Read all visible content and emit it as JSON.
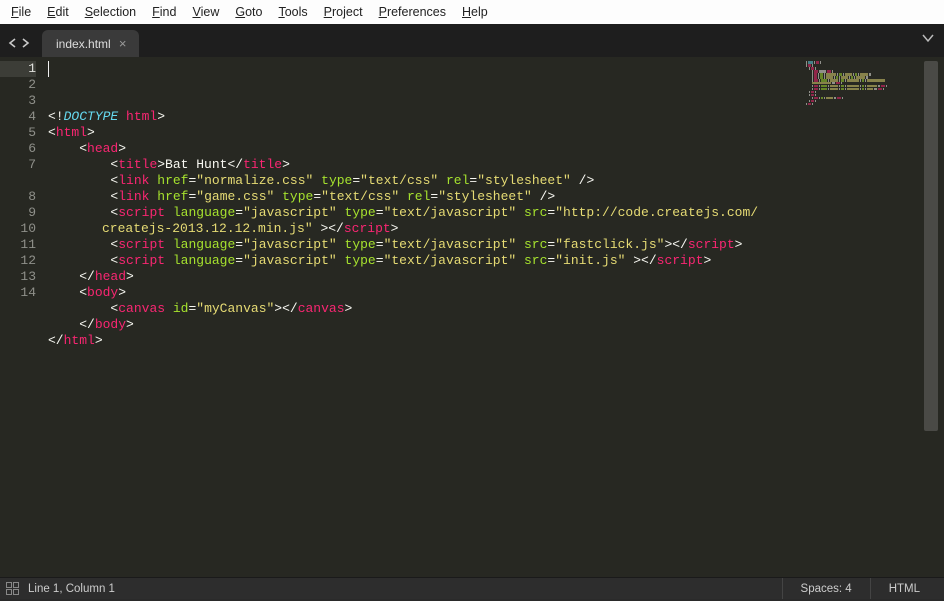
{
  "menu": {
    "file": "ile",
    "edit": "dit",
    "selection": "election",
    "find": "ind",
    "view": "iew",
    "goto": "oto",
    "tools": "ools",
    "project": "roject",
    "preferences": "references",
    "help": "elp",
    "u": {
      "file": "F",
      "edit": "E",
      "selection": "S",
      "find": "F",
      "view": "V",
      "goto": "G",
      "tools": "T",
      "project": "P",
      "preferences": "P",
      "help": "H"
    }
  },
  "tab": {
    "title": "index.html"
  },
  "gutter": [
    "1",
    "2",
    "3",
    "4",
    "5",
    "6",
    "7",
    "8",
    "9",
    "10",
    "11",
    "12",
    "13",
    "14"
  ],
  "code": {
    "lines": [
      [
        {
          "c": "p",
          "t": "<!"
        },
        {
          "c": "doct",
          "t": "DOCTYPE"
        },
        {
          "c": "p",
          "t": " "
        },
        {
          "c": "tg",
          "t": "html"
        },
        {
          "c": "p",
          "t": ">"
        }
      ],
      [
        {
          "c": "p",
          "t": "<"
        },
        {
          "c": "tg",
          "t": "html"
        },
        {
          "c": "p",
          "t": ">"
        }
      ],
      [
        {
          "i": 1
        },
        {
          "c": "p",
          "t": "<"
        },
        {
          "c": "tg",
          "t": "head"
        },
        {
          "c": "p",
          "t": ">"
        }
      ],
      [
        {
          "i": 2
        },
        {
          "c": "p",
          "t": "<"
        },
        {
          "c": "tg",
          "t": "title"
        },
        {
          "c": "p",
          "t": ">Bat Hunt</"
        },
        {
          "c": "tg",
          "t": "title"
        },
        {
          "c": "p",
          "t": ">"
        }
      ],
      [
        {
          "i": 2
        },
        {
          "c": "p",
          "t": "<"
        },
        {
          "c": "tg",
          "t": "link"
        },
        {
          "c": "p",
          "t": " "
        },
        {
          "c": "attr",
          "t": "href"
        },
        {
          "c": "p",
          "t": "="
        },
        {
          "c": "str",
          "t": "\"normalize.css\""
        },
        {
          "c": "p",
          "t": " "
        },
        {
          "c": "attr",
          "t": "type"
        },
        {
          "c": "p",
          "t": "="
        },
        {
          "c": "str",
          "t": "\"text/css\""
        },
        {
          "c": "p",
          "t": " "
        },
        {
          "c": "attr",
          "t": "rel"
        },
        {
          "c": "p",
          "t": "="
        },
        {
          "c": "str",
          "t": "\"stylesheet\""
        },
        {
          "c": "p",
          "t": " />"
        }
      ],
      [
        {
          "i": 2
        },
        {
          "c": "p",
          "t": "<"
        },
        {
          "c": "tg",
          "t": "link"
        },
        {
          "c": "p",
          "t": " "
        },
        {
          "c": "attr",
          "t": "href"
        },
        {
          "c": "p",
          "t": "="
        },
        {
          "c": "str",
          "t": "\"game.css\""
        },
        {
          "c": "p",
          "t": " "
        },
        {
          "c": "attr",
          "t": "type"
        },
        {
          "c": "p",
          "t": "="
        },
        {
          "c": "str",
          "t": "\"text/css\""
        },
        {
          "c": "p",
          "t": " "
        },
        {
          "c": "attr",
          "t": "rel"
        },
        {
          "c": "p",
          "t": "="
        },
        {
          "c": "str",
          "t": "\"stylesheet\""
        },
        {
          "c": "p",
          "t": " />"
        }
      ],
      [
        {
          "i": 2
        },
        {
          "c": "p",
          "t": "<"
        },
        {
          "c": "tg",
          "t": "script"
        },
        {
          "c": "p",
          "t": " "
        },
        {
          "c": "attr",
          "t": "language"
        },
        {
          "c": "p",
          "t": "="
        },
        {
          "c": "str",
          "t": "\"javascript\""
        },
        {
          "c": "p",
          "t": " "
        },
        {
          "c": "attr",
          "t": "type"
        },
        {
          "c": "p",
          "t": "="
        },
        {
          "c": "str",
          "t": "\"text/javascript\""
        },
        {
          "c": "p",
          "t": " "
        },
        {
          "c": "attr",
          "t": "src"
        },
        {
          "c": "p",
          "t": "="
        },
        {
          "c": "str",
          "t": "\"http://code.createjs.com/"
        }
      ],
      [
        {
          "wrap": true
        },
        {
          "c": "str",
          "t": "createjs-2013.12.12.min.js\""
        },
        {
          "c": "p",
          "t": " ></"
        },
        {
          "c": "tg",
          "t": "script"
        },
        {
          "c": "p",
          "t": ">"
        }
      ],
      [
        {
          "i": 2
        },
        {
          "c": "p",
          "t": "<"
        },
        {
          "c": "tg",
          "t": "script"
        },
        {
          "c": "p",
          "t": " "
        },
        {
          "c": "attr",
          "t": "language"
        },
        {
          "c": "p",
          "t": "="
        },
        {
          "c": "str",
          "t": "\"javascript\""
        },
        {
          "c": "p",
          "t": " "
        },
        {
          "c": "attr",
          "t": "type"
        },
        {
          "c": "p",
          "t": "="
        },
        {
          "c": "str",
          "t": "\"text/javascript\""
        },
        {
          "c": "p",
          "t": " "
        },
        {
          "c": "attr",
          "t": "src"
        },
        {
          "c": "p",
          "t": "="
        },
        {
          "c": "str",
          "t": "\"fastclick.js\""
        },
        {
          "c": "p",
          "t": "></"
        },
        {
          "c": "tg",
          "t": "script"
        },
        {
          "c": "p",
          "t": ">"
        }
      ],
      [
        {
          "i": 2
        },
        {
          "c": "p",
          "t": "<"
        },
        {
          "c": "tg",
          "t": "script"
        },
        {
          "c": "p",
          "t": " "
        },
        {
          "c": "attr",
          "t": "language"
        },
        {
          "c": "p",
          "t": "="
        },
        {
          "c": "str",
          "t": "\"javascript\""
        },
        {
          "c": "p",
          "t": " "
        },
        {
          "c": "attr",
          "t": "type"
        },
        {
          "c": "p",
          "t": "="
        },
        {
          "c": "str",
          "t": "\"text/javascript\""
        },
        {
          "c": "p",
          "t": " "
        },
        {
          "c": "attr",
          "t": "src"
        },
        {
          "c": "p",
          "t": "="
        },
        {
          "c": "str",
          "t": "\"init.js\""
        },
        {
          "c": "p",
          "t": " ></"
        },
        {
          "c": "tg",
          "t": "script"
        },
        {
          "c": "p",
          "t": ">"
        }
      ],
      [
        {
          "i": 1
        },
        {
          "c": "p",
          "t": "</"
        },
        {
          "c": "tg",
          "t": "head"
        },
        {
          "c": "p",
          "t": ">"
        }
      ],
      [
        {
          "i": 1
        },
        {
          "c": "p",
          "t": "<"
        },
        {
          "c": "tg",
          "t": "body"
        },
        {
          "c": "p",
          "t": ">"
        }
      ],
      [
        {
          "i": 2
        },
        {
          "c": "p",
          "t": "<"
        },
        {
          "c": "tg",
          "t": "canvas"
        },
        {
          "c": "p",
          "t": " "
        },
        {
          "c": "attr",
          "t": "id"
        },
        {
          "c": "p",
          "t": "="
        },
        {
          "c": "str",
          "t": "\"myCanvas\""
        },
        {
          "c": "p",
          "t": "></"
        },
        {
          "c": "tg",
          "t": "canvas"
        },
        {
          "c": "p",
          "t": ">"
        }
      ],
      [
        {
          "i": 1
        },
        {
          "c": "p",
          "t": "</"
        },
        {
          "c": "tg",
          "t": "body"
        },
        {
          "c": "p",
          "t": ">"
        }
      ],
      [
        {
          "c": "p",
          "t": "</"
        },
        {
          "c": "tg",
          "t": "html"
        },
        {
          "c": "p",
          "t": ">"
        }
      ]
    ]
  },
  "status": {
    "selection": "Line 1, Column 1",
    "spaces": "Spaces: 4",
    "syntax": "HTML"
  }
}
